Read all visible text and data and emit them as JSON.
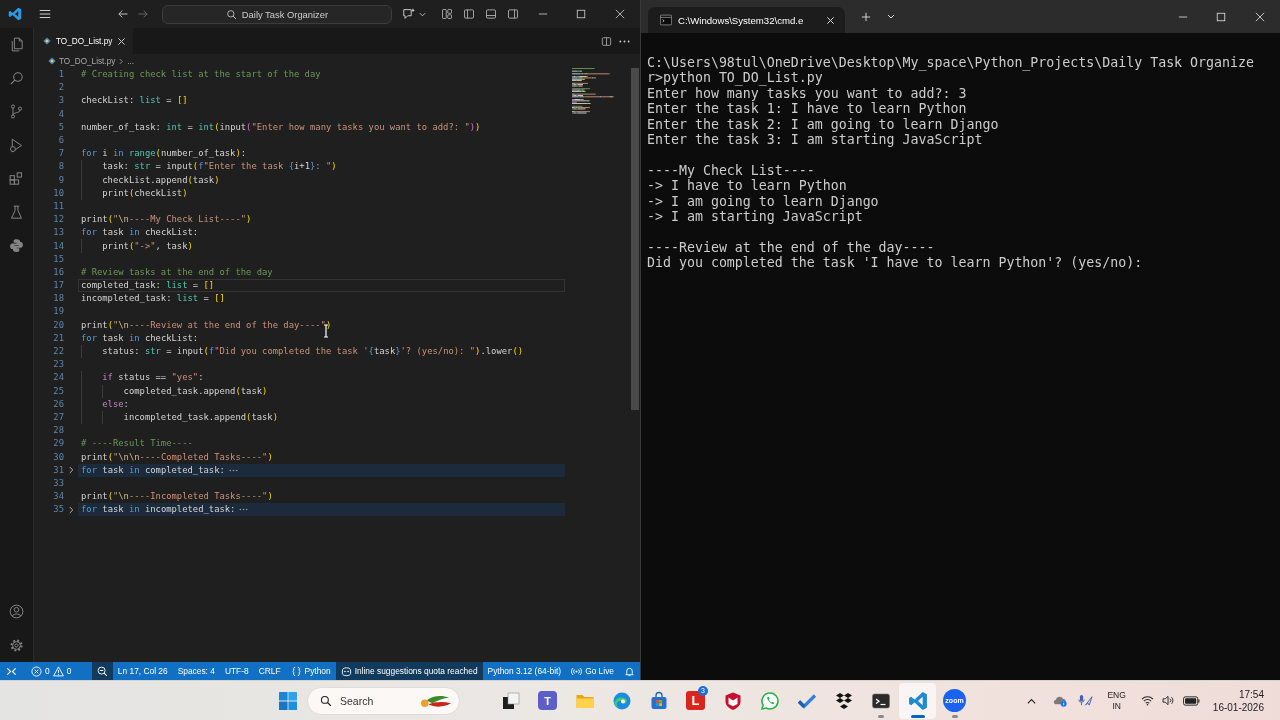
{
  "vscode": {
    "command_center": "Daily Task Organizer",
    "tabs": [
      {
        "label": "TO_DO_List.py",
        "selected": true
      }
    ],
    "breadcrumb": [
      "TO_DO_List.py",
      "..."
    ],
    "lines": [
      {
        "number": "1",
        "current": false,
        "folded": false,
        "tokens": [
          {
            "text": "# Creating check list at the start of the day",
            "kind": "comment"
          }
        ]
      },
      {
        "number": "2",
        "current": false,
        "folded": false
      },
      {
        "number": "3",
        "current": false,
        "folded": false,
        "tokens": [
          {
            "text": "checkList: ",
            "kind": "plain"
          },
          {
            "text": "list",
            "kind": "type"
          },
          {
            "text": " = ",
            "kind": "plain"
          },
          {
            "text": "[]",
            "kind": "bracket1"
          }
        ]
      },
      {
        "number": "4",
        "current": false,
        "folded": false
      },
      {
        "number": "5",
        "current": false,
        "folded": false,
        "tokens": [
          {
            "text": "number_of_task: ",
            "kind": "plain"
          },
          {
            "text": "int",
            "kind": "type"
          },
          {
            "text": " = ",
            "kind": "plain"
          },
          {
            "text": "int",
            "kind": "type"
          },
          {
            "text": "(",
            "kind": "bracket1"
          },
          {
            "text": "input",
            "kind": "plain"
          },
          {
            "text": "(",
            "kind": "bracket2"
          },
          {
            "text": "\"Enter how many tasks you want to add?: \"",
            "kind": "string"
          },
          {
            "text": ")",
            "kind": "bracket2"
          },
          {
            "text": ")",
            "kind": "bracket1"
          }
        ]
      },
      {
        "number": "6",
        "current": false,
        "folded": false
      },
      {
        "number": "7",
        "current": false,
        "folded": false,
        "tokens": [
          {
            "text": "for",
            "kind": "keyword"
          },
          {
            "text": " i ",
            "kind": "plain"
          },
          {
            "text": "in ",
            "kind": "keyword"
          },
          {
            "text": "range",
            "kind": "type"
          },
          {
            "text": "(",
            "kind": "bracket1"
          },
          {
            "text": "number_of_task",
            "kind": "plain"
          },
          {
            "text": ")",
            "kind": "bracket1"
          },
          {
            "text": ":",
            "kind": "plain"
          }
        ]
      },
      {
        "number": "8",
        "current": false,
        "folded": false,
        "tokens": [
          {
            "text": "    task: ",
            "kind": "plain"
          },
          {
            "text": "str",
            "kind": "type"
          },
          {
            "text": " = input",
            "kind": "plain"
          },
          {
            "text": "(",
            "kind": "bracket1"
          },
          {
            "text": "f",
            "kind": "fprefix"
          },
          {
            "text": "\"Enter the task ",
            "kind": "string"
          },
          {
            "text": "{",
            "kind": "fbrace"
          },
          {
            "text": "i+1",
            "kind": "plain"
          },
          {
            "text": "}",
            "kind": "fbrace"
          },
          {
            "text": ": \"",
            "kind": "string"
          },
          {
            "text": ")",
            "kind": "bracket1"
          }
        ]
      },
      {
        "number": "9",
        "current": false,
        "folded": false,
        "tokens": [
          {
            "text": "    checkList.append",
            "kind": "plain"
          },
          {
            "text": "(",
            "kind": "bracket1"
          },
          {
            "text": "task",
            "kind": "plain"
          },
          {
            "text": ")",
            "kind": "bracket1"
          }
        ]
      },
      {
        "number": "10",
        "current": false,
        "folded": false,
        "tokens": [
          {
            "text": "    print",
            "kind": "plain"
          },
          {
            "text": "(",
            "kind": "bracket1"
          },
          {
            "text": "checkList",
            "kind": "plain"
          },
          {
            "text": ")",
            "kind": "bracket1"
          }
        ]
      },
      {
        "number": "11",
        "current": false,
        "folded": false
      },
      {
        "number": "12",
        "current": false,
        "folded": false,
        "tokens": [
          {
            "text": "print",
            "kind": "plain"
          },
          {
            "text": "(",
            "kind": "bracket1"
          },
          {
            "text": "\"",
            "kind": "string"
          },
          {
            "text": "\\n",
            "kind": "escape"
          },
          {
            "text": "----My Check List----\"",
            "kind": "string"
          },
          {
            "text": ")",
            "kind": "bracket1"
          }
        ]
      },
      {
        "number": "13",
        "current": false,
        "folded": false,
        "tokens": [
          {
            "text": "for",
            "kind": "keyword"
          },
          {
            "text": " task ",
            "kind": "plain"
          },
          {
            "text": "in",
            "kind": "keyword"
          },
          {
            "text": " checkList:",
            "kind": "plain"
          }
        ]
      },
      {
        "number": "14",
        "current": false,
        "folded": false,
        "tokens": [
          {
            "text": "    print",
            "kind": "plain"
          },
          {
            "text": "(",
            "kind": "bracket1"
          },
          {
            "text": "\"->\"",
            "kind": "string"
          },
          {
            "text": ", task",
            "kind": "plain"
          },
          {
            "text": ")",
            "kind": "bracket1"
          }
        ]
      },
      {
        "number": "15",
        "current": false,
        "folded": false
      },
      {
        "number": "16",
        "current": false,
        "folded": false,
        "tokens": [
          {
            "text": "# Review tasks at the end of the day",
            "kind": "comment"
          }
        ]
      },
      {
        "number": "17",
        "current": true,
        "folded": false,
        "tokens": [
          {
            "text": "completed_task: ",
            "kind": "plain"
          },
          {
            "text": "list",
            "kind": "type"
          },
          {
            "text": " = ",
            "kind": "plain"
          },
          {
            "text": "[]",
            "kind": "bracket1"
          }
        ]
      },
      {
        "number": "18",
        "current": false,
        "folded": false,
        "tokens": [
          {
            "text": "incompleted_task: ",
            "kind": "plain"
          },
          {
            "text": "list",
            "kind": "type"
          },
          {
            "text": " = ",
            "kind": "plain"
          },
          {
            "text": "[]",
            "kind": "bracket1"
          }
        ]
      },
      {
        "number": "19",
        "current": false,
        "folded": false
      },
      {
        "number": "20",
        "current": false,
        "folded": false,
        "tokens": [
          {
            "text": "print",
            "kind": "plain"
          },
          {
            "text": "(",
            "kind": "bracket1"
          },
          {
            "text": "\"",
            "kind": "string"
          },
          {
            "text": "\\n",
            "kind": "escape"
          },
          {
            "text": "----Review at the end of the day----\"",
            "kind": "string"
          },
          {
            "text": ")",
            "kind": "bracket1"
          }
        ]
      },
      {
        "number": "21",
        "current": false,
        "folded": false,
        "tokens": [
          {
            "text": "for",
            "kind": "keyword"
          },
          {
            "text": " task ",
            "kind": "plain"
          },
          {
            "text": "in",
            "kind": "keyword"
          },
          {
            "text": " checkList:",
            "kind": "plain"
          }
        ]
      },
      {
        "number": "22",
        "current": false,
        "folded": false,
        "tokens": [
          {
            "text": "    status: ",
            "kind": "plain"
          },
          {
            "text": "str",
            "kind": "type"
          },
          {
            "text": " = input",
            "kind": "plain"
          },
          {
            "text": "(",
            "kind": "bracket1"
          },
          {
            "text": "f",
            "kind": "fprefix"
          },
          {
            "text": "\"Did you completed the task '",
            "kind": "string"
          },
          {
            "text": "{",
            "kind": "fbrace"
          },
          {
            "text": "task",
            "kind": "plain"
          },
          {
            "text": "}",
            "kind": "fbrace"
          },
          {
            "text": "'? (yes/no): \"",
            "kind": "string"
          },
          {
            "text": ")",
            "kind": "bracket1"
          },
          {
            "text": ".lower",
            "kind": "plain"
          },
          {
            "text": "()",
            "kind": "bracket1"
          }
        ]
      },
      {
        "number": "23",
        "current": false,
        "folded": false
      },
      {
        "number": "24",
        "current": false,
        "folded": false,
        "tokens": [
          {
            "text": "    if",
            "kind": "control"
          },
          {
            "text": " status == ",
            "kind": "plain"
          },
          {
            "text": "\"yes\"",
            "kind": "string"
          },
          {
            "text": ":",
            "kind": "plain"
          }
        ]
      },
      {
        "number": "25",
        "current": false,
        "folded": false,
        "tokens": [
          {
            "text": "        completed_task.append",
            "kind": "plain"
          },
          {
            "text": "(",
            "kind": "bracket1"
          },
          {
            "text": "task",
            "kind": "plain"
          },
          {
            "text": ")",
            "kind": "bracket1"
          }
        ]
      },
      {
        "number": "26",
        "current": false,
        "folded": false,
        "tokens": [
          {
            "text": "    else",
            "kind": "control"
          },
          {
            "text": ":",
            "kind": "plain"
          }
        ]
      },
      {
        "number": "27",
        "current": false,
        "folded": false,
        "tokens": [
          {
            "text": "        incompleted_task.append",
            "kind": "plain"
          },
          {
            "text": "(",
            "kind": "bracket1"
          },
          {
            "text": "task",
            "kind": "plain"
          },
          {
            "text": ")",
            "kind": "bracket1"
          }
        ]
      },
      {
        "number": "28",
        "current": false,
        "folded": false
      },
      {
        "number": "29",
        "current": false,
        "folded": false,
        "tokens": [
          {
            "text": "# ----Result Time----",
            "kind": "comment"
          }
        ]
      },
      {
        "number": "30",
        "current": false,
        "folded": false,
        "tokens": [
          {
            "text": "print",
            "kind": "plain"
          },
          {
            "text": "(",
            "kind": "bracket1"
          },
          {
            "text": "\"",
            "kind": "string"
          },
          {
            "text": "\\n\\n",
            "kind": "escape"
          },
          {
            "text": "----Completed Tasks----\"",
            "kind": "string"
          },
          {
            "text": ")",
            "kind": "bracket1"
          }
        ]
      },
      {
        "number": "31",
        "current": false,
        "folded": true,
        "tokens": [
          {
            "text": "for",
            "kind": "keyword"
          },
          {
            "text": " task ",
            "kind": "plain"
          },
          {
            "text": "in",
            "kind": "keyword"
          },
          {
            "text": " completed_task:",
            "kind": "plain"
          }
        ]
      },
      {
        "number": "33",
        "current": false,
        "folded": false
      },
      {
        "number": "34",
        "current": false,
        "folded": false,
        "tokens": [
          {
            "text": "print",
            "kind": "plain"
          },
          {
            "text": "(",
            "kind": "bracket1"
          },
          {
            "text": "\"",
            "kind": "string"
          },
          {
            "text": "\\n",
            "kind": "escape"
          },
          {
            "text": "----Incompleted Tasks----\"",
            "kind": "string"
          },
          {
            "text": ")",
            "kind": "bracket1"
          }
        ]
      },
      {
        "number": "35",
        "current": false,
        "folded": true,
        "tokens": [
          {
            "text": "for",
            "kind": "keyword"
          },
          {
            "text": " task ",
            "kind": "plain"
          },
          {
            "text": "in",
            "kind": "keyword"
          },
          {
            "text": " incompleted_task:",
            "kind": "plain"
          }
        ]
      }
    ],
    "status_bar": {
      "left": [
        {
          "kind": "remote",
          "highlighted": false
        },
        {
          "kind": "problems",
          "errors": "0",
          "warnings": "0",
          "highlighted": false
        }
      ],
      "right": [
        {
          "kind": "zoom",
          "highlighted": true
        },
        {
          "kind": "text",
          "text": "Ln 17, Col 26",
          "highlighted": false
        },
        {
          "kind": "text",
          "text": "Spaces: 4",
          "highlighted": false
        },
        {
          "kind": "text",
          "text": "UTF-8",
          "highlighted": false
        },
        {
          "kind": "text",
          "text": "CRLF",
          "highlighted": false
        },
        {
          "kind": "language",
          "text": "Python",
          "highlighted": false
        },
        {
          "kind": "copilot",
          "text": "Inline suggestions quota reached",
          "highlighted": true
        },
        {
          "kind": "text",
          "text": "Python 3.12 (64-bit)",
          "highlighted": false
        },
        {
          "kind": "live",
          "text": "Go Live",
          "highlighted": false
        },
        {
          "kind": "bell",
          "highlighted": false
        }
      ]
    }
  },
  "terminal": {
    "tabs": [
      {
        "title": "C:\\Windows\\System32\\cmd.e",
        "selected": true
      }
    ],
    "blocks": [
      {
        "lines": [
          "C:\\Users\\98tul\\OneDrive\\Desktop\\My_space\\Python_Projects\\Daily Task Organize",
          "r>python TO_DO_List.py",
          "Enter how many tasks you want to add?: 3",
          "Enter the task 1: I have to learn Python",
          "Enter the task 2: I am going to learn Django",
          "Enter the task 3: I am starting JavaScript"
        ]
      },
      {
        "lines": [
          "----My Check List----",
          "-> I have to learn Python",
          "-> I am going to learn Django",
          "-> I am starting JavaScript"
        ]
      },
      {
        "lines": [
          "----Review at the end of the day----",
          "Did you completed the task 'I have to learn Python'? (yes/no):"
        ]
      }
    ]
  },
  "taskbar": {
    "search": {
      "placeholder": "Search"
    },
    "apps": [
      {
        "kind": "taskview",
        "running": false,
        "selected": false
      },
      {
        "kind": "people",
        "logo": "T",
        "running": false,
        "selected": false
      },
      {
        "kind": "folder",
        "running": false,
        "selected": false
      },
      {
        "kind": "browser",
        "running": false,
        "selected": false
      },
      {
        "kind": "store",
        "running": false,
        "selected": false
      },
      {
        "kind": "letter",
        "logo": "L",
        "badge": "3",
        "running": false,
        "selected": false
      },
      {
        "kind": "shield",
        "running": false,
        "selected": false
      },
      {
        "kind": "phone",
        "running": false,
        "selected": false
      },
      {
        "kind": "check",
        "running": false,
        "selected": false
      },
      {
        "kind": "boxes",
        "running": false,
        "selected": false
      },
      {
        "kind": "terminal",
        "running": true,
        "selected": false
      },
      {
        "kind": "editor",
        "running": true,
        "selected": true
      },
      {
        "kind": "video",
        "logo": "zoom",
        "running": true,
        "selected": false
      }
    ],
    "tray": {
      "language": "ENG",
      "region": "IN",
      "time": "17:54",
      "date": "16-01-2026"
    }
  }
}
